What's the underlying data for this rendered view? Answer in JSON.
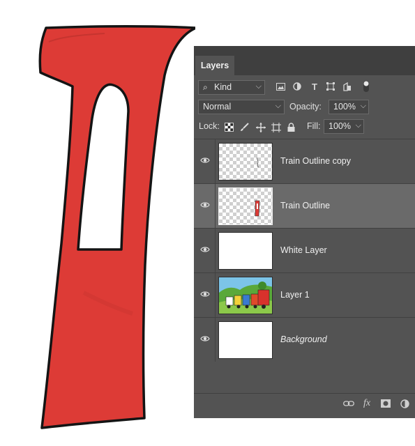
{
  "panel": {
    "tab_label": "Layers",
    "filter": {
      "kind_label": "Kind",
      "icons": [
        "image-filter-icon",
        "adjustment-filter-icon",
        "type-filter-icon",
        "shape-filter-icon",
        "smart-object-filter-icon",
        "filter-toggle-icon"
      ]
    },
    "blend_mode": "Normal",
    "opacity_label": "Opacity:",
    "opacity_value": "100%",
    "lock_label": "Lock:",
    "lock_icons": [
      "lock-transparent-pixels-icon",
      "lock-image-pixels-icon",
      "lock-position-icon",
      "lock-artboard-icon",
      "lock-all-icon"
    ],
    "fill_label": "Fill:",
    "fill_value": "100%",
    "layers": [
      {
        "name": "Train Outline copy",
        "thumbnail": "transparent-sketch",
        "visible": true,
        "selected": false
      },
      {
        "name": "Train Outline",
        "thumbnail": "transparent-red-shape",
        "visible": true,
        "selected": true
      },
      {
        "name": "White Layer",
        "thumbnail": "white",
        "visible": true,
        "selected": false
      },
      {
        "name": "Layer 1",
        "thumbnail": "train-illustration",
        "visible": true,
        "selected": false
      },
      {
        "name": "Background",
        "thumbnail": "white",
        "visible": true,
        "selected": false,
        "italic": true
      }
    ],
    "bottom_icons": [
      "link-layers-icon",
      "layer-style-fx-icon",
      "layer-mask-icon",
      "adjustment-layer-icon"
    ],
    "fx_label": "fx"
  },
  "colors": {
    "panel_bg": "#535353",
    "selected_row": "#6a6a6a",
    "shape_red": "#dd3b36"
  }
}
